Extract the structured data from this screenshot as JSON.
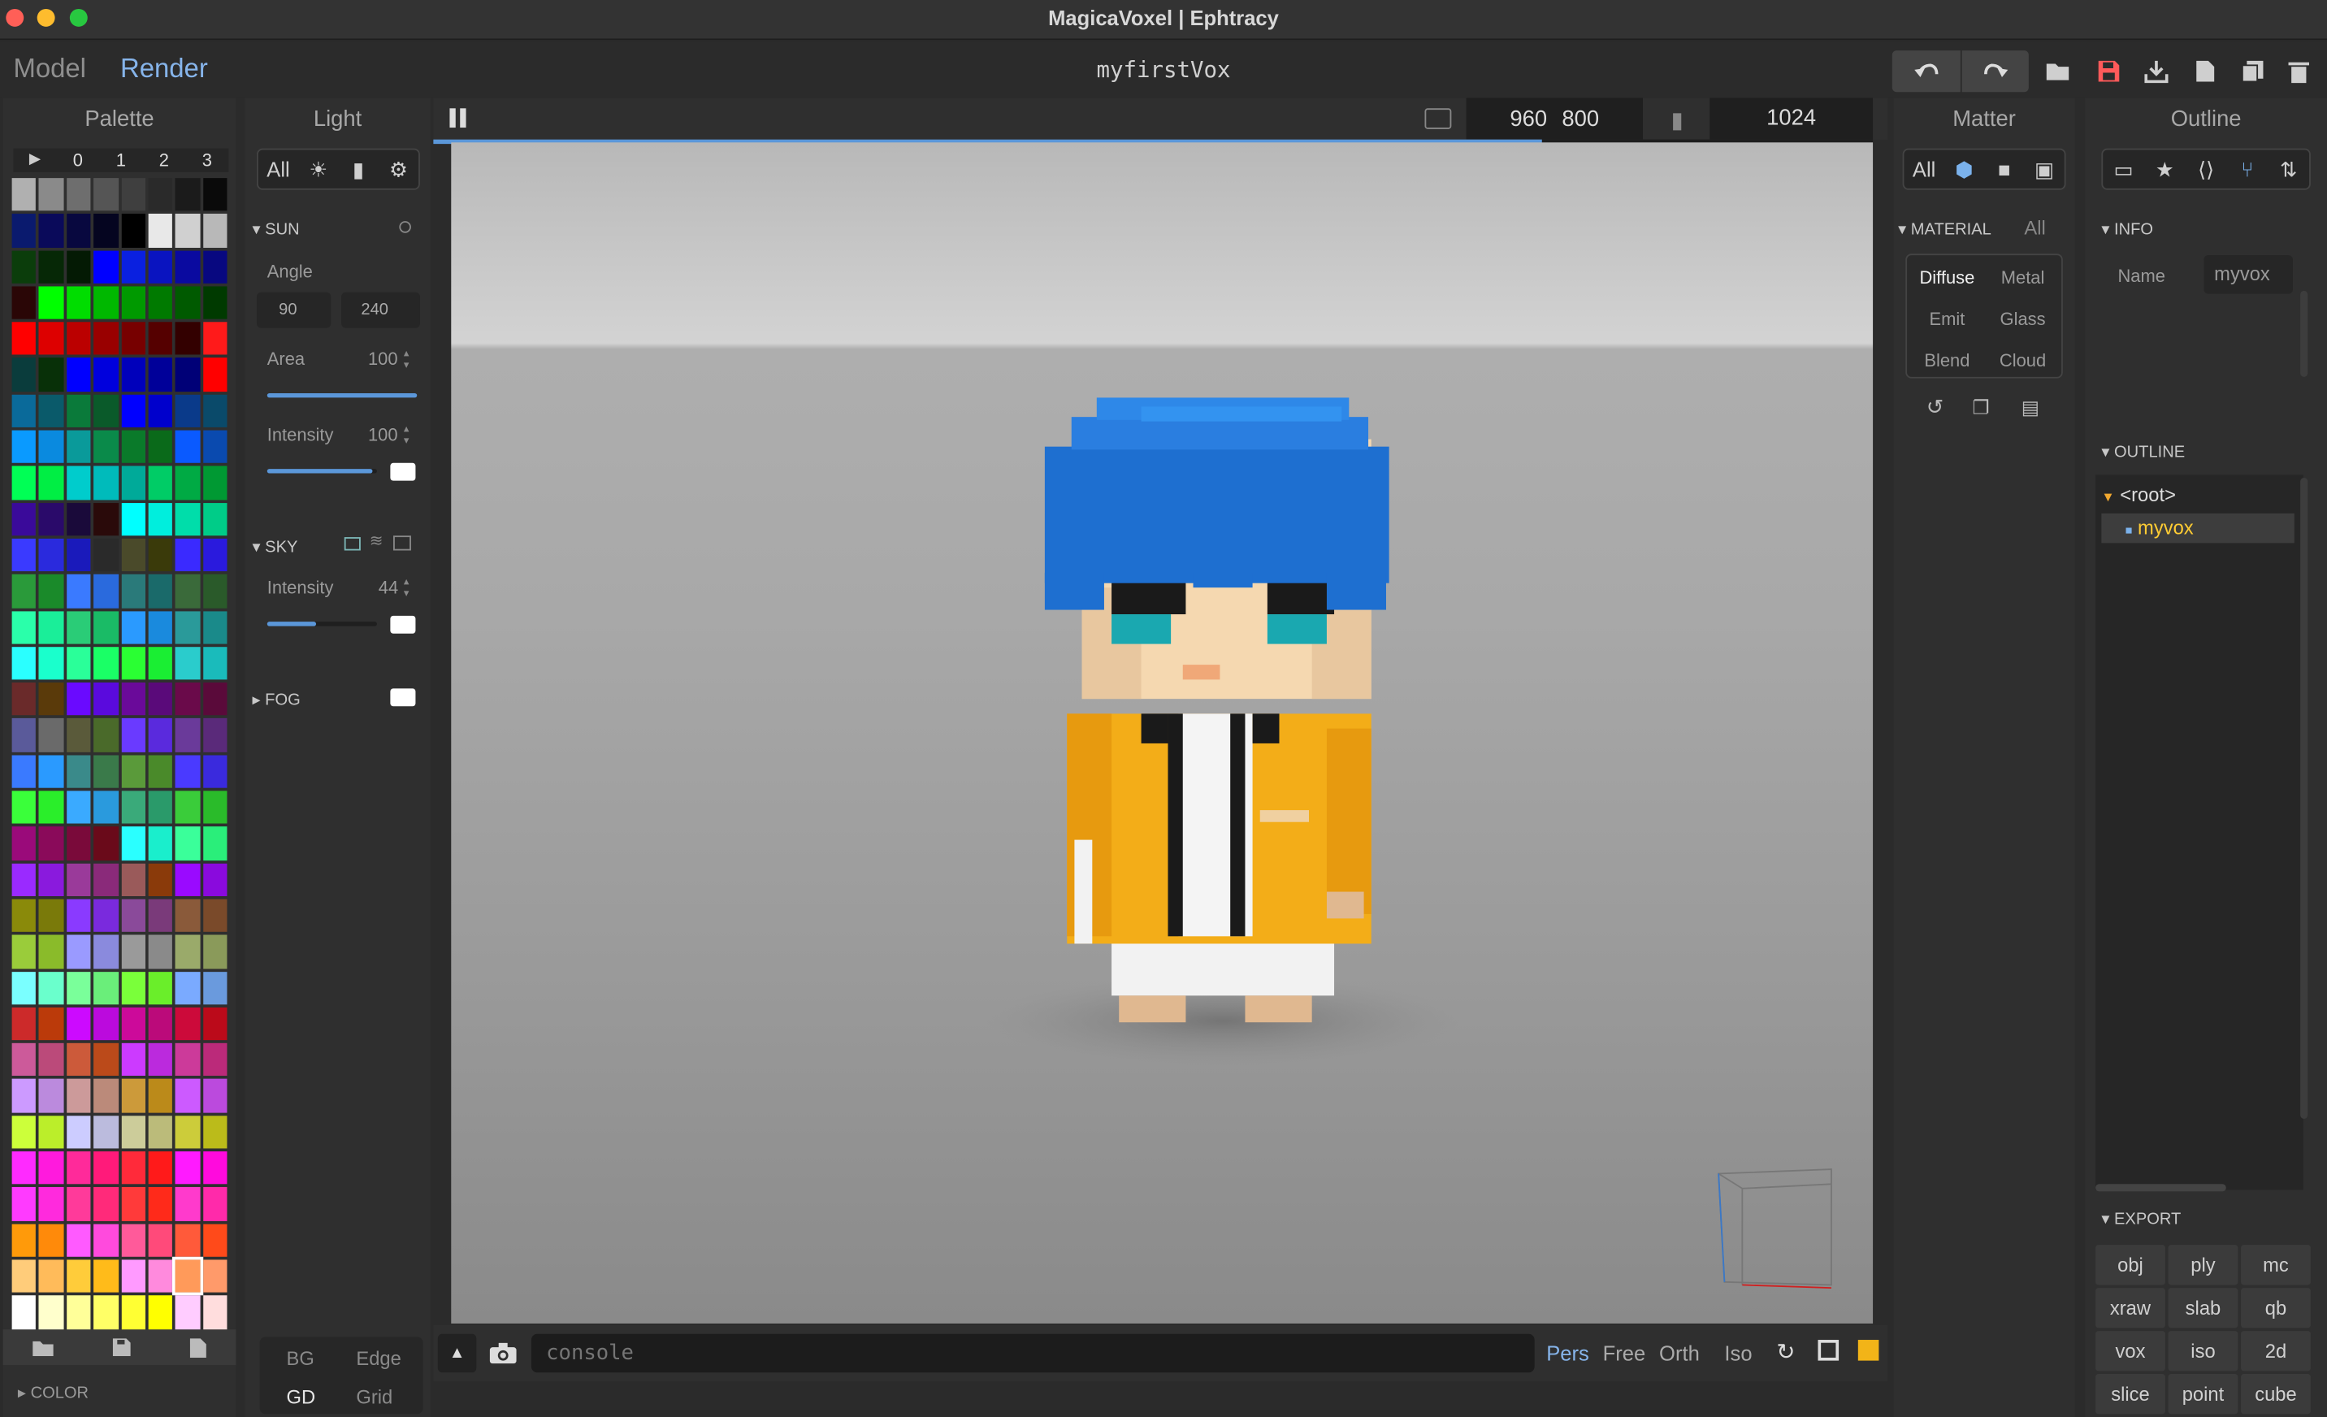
{
  "window": {
    "title": "MagicaVoxel | Ephtracy"
  },
  "toolbar": {
    "modes": [
      "Model",
      "Render"
    ],
    "active_mode": "Render",
    "doc_title": "myfirstVox",
    "icons": [
      "undo-icon",
      "redo-icon",
      "open-folder-icon",
      "save-icon",
      "export-icon",
      "new-file-icon",
      "duplicate-icon",
      "trash-icon"
    ]
  },
  "palette": {
    "title": "Palette",
    "tabs": [
      "0",
      "1",
      "2",
      "3"
    ],
    "colors": [
      "#b0b0b0",
      "#8a8a8a",
      "#6e6e6e",
      "#555555",
      "#3f3f3f",
      "#2a2a2a",
      "#1b1b1b",
      "#0a0a0a",
      "#0a1a6e",
      "#0a0a5a",
      "#08083f",
      "#050520",
      "#000000",
      "#e8e8e8",
      "#d0d0d0",
      "#b8b8b8",
      "#0b3d0b",
      "#062806",
      "#041a04",
      "#0000ff",
      "#0a20e0",
      "#0a14c0",
      "#0a0aa0",
      "#080880",
      "#2a0606",
      "#00ff00",
      "#00dd00",
      "#00b800",
      "#009a00",
      "#007a00",
      "#005a00",
      "#003a00",
      "#ff0000",
      "#dd0000",
      "#bb0000",
      "#990000",
      "#770000",
      "#550000",
      "#330000",
      "#ff1a1a",
      "#0a3c3c",
      "#083008",
      "#0000ff",
      "#0000dd",
      "#0000bb",
      "#000099",
      "#000077",
      "#ff0000",
      "#0a6a9a",
      "#0a5a6a",
      "#0a7a3a",
      "#0a5a2a",
      "#0000ff",
      "#0000cc",
      "#0a3a8a",
      "#0a4a6a",
      "#0a9aff",
      "#0a8adf",
      "#0a9a9a",
      "#0a8a4a",
      "#0a7a2a",
      "#0a6a1a",
      "#0a5aff",
      "#0a4aaf",
      "#00ff55",
      "#00ee44",
      "#00cccc",
      "#00bbbb",
      "#00aa99",
      "#00cc66",
      "#00aa44",
      "#009933",
      "#3a0a9a",
      "#2a0a6a",
      "#1a0a3a",
      "#2a0a0a",
      "#00ffff",
      "#00eedd",
      "#00ddaa",
      "#00cc88",
      "#3a3aff",
      "#2a2add",
      "#1a1abb",
      "#2a2a2a",
      "#4a4a2a",
      "#3a3a0a",
      "#3a2aff",
      "#2a1add",
      "#2a9a3a",
      "#1a8a2a",
      "#3a7aff",
      "#2a6add",
      "#2a7a7a",
      "#1a6a6a",
      "#3a6a3a",
      "#2a5a2a",
      "#2affaa",
      "#1aee99",
      "#2acc77",
      "#1abb66",
      "#2a9aff",
      "#1a8add",
      "#2a9a9a",
      "#1a8a8a",
      "#2affff",
      "#1affcc",
      "#2aff99",
      "#1aff66",
      "#2aff33",
      "#1aee33",
      "#2acccc",
      "#1abbbb",
      "#6a2a2a",
      "#5a3a0a",
      "#6a0aff",
      "#5a0add",
      "#6a0a9a",
      "#5a0a7a",
      "#6a0a4a",
      "#5a0a3a",
      "#5a5a9a",
      "#6a6a6a",
      "#5a5a3a",
      "#4a6a2a",
      "#6a3aff",
      "#5a2add",
      "#6a3a9a",
      "#5a2a7a",
      "#3a7aff",
      "#2a9aff",
      "#3a8a8a",
      "#3a7a4a",
      "#5a9a3a",
      "#4a8a2a",
      "#4a3aff",
      "#3a2add",
      "#3aff3a",
      "#2aee2a",
      "#3aaaff",
      "#2a9add",
      "#3aaa7a",
      "#2a9a6a",
      "#3acc3a",
      "#2abb2a",
      "#9a0a7a",
      "#8a0a5a",
      "#7a0a3a",
      "#6a0a1a",
      "#2affff",
      "#1aeecc",
      "#3aff9a",
      "#2aee7a",
      "#9a2aff",
      "#8a1add",
      "#9a3a9a",
      "#8a2a7a",
      "#9a5a5a",
      "#8a3a0a",
      "#9a0aff",
      "#8a0add",
      "#8a8a0a",
      "#7a7a0a",
      "#8a3aff",
      "#7a2add",
      "#8a4a9a",
      "#7a3a7a",
      "#8a5a3a",
      "#7a4a2a",
      "#9acc3a",
      "#8abb2a",
      "#9a9aff",
      "#8a8add",
      "#9a9a9a",
      "#8a8a8a",
      "#9aaa6a",
      "#8a9a5a",
      "#7affff",
      "#6affcc",
      "#7aff9a",
      "#6aee7a",
      "#7aff3a",
      "#6aee2a",
      "#7aaaff",
      "#6a9add",
      "#cc2a2a",
      "#bb3a0a",
      "#cc0aff",
      "#bb0add",
      "#cc0a9a",
      "#bb0a7a",
      "#cc0a3a",
      "#bb0a1a",
      "#cc5a9a",
      "#bb4a7a",
      "#cc5a3a",
      "#bb4a1a",
      "#cc3aff",
      "#bb2add",
      "#cc3a9a",
      "#bb2a7a",
      "#cc9aff",
      "#bb8add",
      "#cc9a9a",
      "#bb8a7a",
      "#cc9a3a",
      "#bb8a1a",
      "#cc5aff",
      "#bb4add",
      "#ccff3a",
      "#bbee2a",
      "#ccccff",
      "#bbbbdd",
      "#cccc9a",
      "#bbbb7a",
      "#cccc3a",
      "#bbbb1a",
      "#ff2aff",
      "#ff1add",
      "#ff2a9a",
      "#ff1a7a",
      "#ff2a3a",
      "#ff1a1a",
      "#ff1aff",
      "#ff0add",
      "#ff3aff",
      "#ff2add",
      "#ff3a9a",
      "#ff2a7a",
      "#ff3a3a",
      "#ff2a1a",
      "#ff3acc",
      "#ff2aaa",
      "#ff9a0a",
      "#ff8a0a",
      "#ff5aff",
      "#ff4add",
      "#ff5a9a",
      "#ff4a7a",
      "#ff5a3a",
      "#ff4a1a",
      "#ffcc7a",
      "#ffbb5a",
      "#ffcc3a",
      "#ffbb1a",
      "#ff9aff",
      "#ff8add",
      "#ff9a9a",
      "#ff9a6a",
      "#ffffff",
      "#ffffcc",
      "#ffff99",
      "#ffff66",
      "#ffff33",
      "#ffff00",
      "#ffccff",
      "#ffdddd"
    ],
    "footer_icons": [
      "folder-icon",
      "save-icon",
      "file-icon"
    ],
    "color_section": "COLOR"
  },
  "light": {
    "title": "Light",
    "tabs": [
      "All"
    ],
    "sun": {
      "label": "SUN",
      "angle_label": "Angle",
      "angle_1": "90",
      "angle_2": "240",
      "area_label": "Area",
      "area": "100",
      "area_fill": 1.0,
      "intensity_label": "Intensity",
      "intensity": "100",
      "intensity_fill": 0.96
    },
    "sky": {
      "label": "SKY",
      "intensity_label": "Intensity",
      "intensity": "44",
      "intensity_fill": 0.44
    },
    "fog": {
      "label": "FOG"
    },
    "bottom": {
      "bg": "BG",
      "edge": "Edge",
      "gd": "GD",
      "grid": "Grid"
    }
  },
  "render": {
    "width": "960",
    "height": "800",
    "samples": "1024",
    "progress": 0.77,
    "console_placeholder": "console",
    "views": [
      "Pers",
      "Free",
      "Orth",
      "Iso"
    ],
    "active_view": "Pers"
  },
  "matter": {
    "title": "Matter",
    "tabs": [
      "All"
    ],
    "material_label": "MATERIAL",
    "material_all": "All",
    "materials": [
      "Diffuse",
      "Metal",
      "Emit",
      "Glass",
      "Blend",
      "Cloud"
    ],
    "active_material": "Diffuse"
  },
  "outline": {
    "title": "Outline",
    "info_label": "INFO",
    "name_label": "Name",
    "name_value": "myvox",
    "outline_label": "OUTLINE",
    "tree": [
      "<root>",
      "myvox"
    ],
    "export_label": "EXPORT",
    "export_buttons": [
      "obj",
      "ply",
      "mc",
      "xraw",
      "slab",
      "qb",
      "vox",
      "iso",
      "2d",
      "slice",
      "point",
      "cube"
    ]
  },
  "colors": {
    "accent": "#5b97d9",
    "selected": "#ffcc33",
    "save_red": "#ff5a5a"
  }
}
